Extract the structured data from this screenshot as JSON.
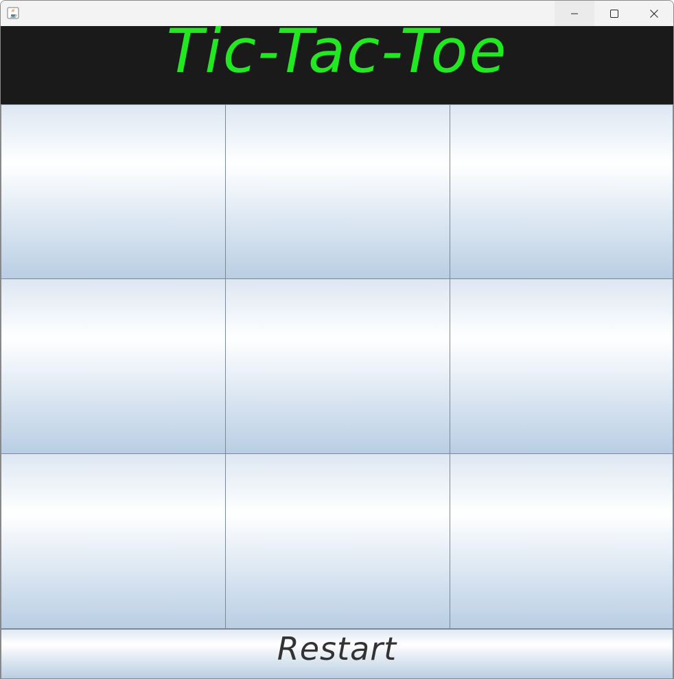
{
  "window": {
    "title": "",
    "icon": "java-icon",
    "controls": {
      "minimize_icon": "minimize-icon",
      "maximize_icon": "maximize-icon",
      "close_icon": "close-icon"
    }
  },
  "header": {
    "title": "Tic-Tac-Toe",
    "text_color": "#22e822",
    "background": "#1a1a1a"
  },
  "board": {
    "cells": [
      {
        "value": ""
      },
      {
        "value": ""
      },
      {
        "value": ""
      },
      {
        "value": ""
      },
      {
        "value": ""
      },
      {
        "value": ""
      },
      {
        "value": ""
      },
      {
        "value": ""
      },
      {
        "value": ""
      }
    ]
  },
  "footer": {
    "restart_label": "Restart"
  }
}
